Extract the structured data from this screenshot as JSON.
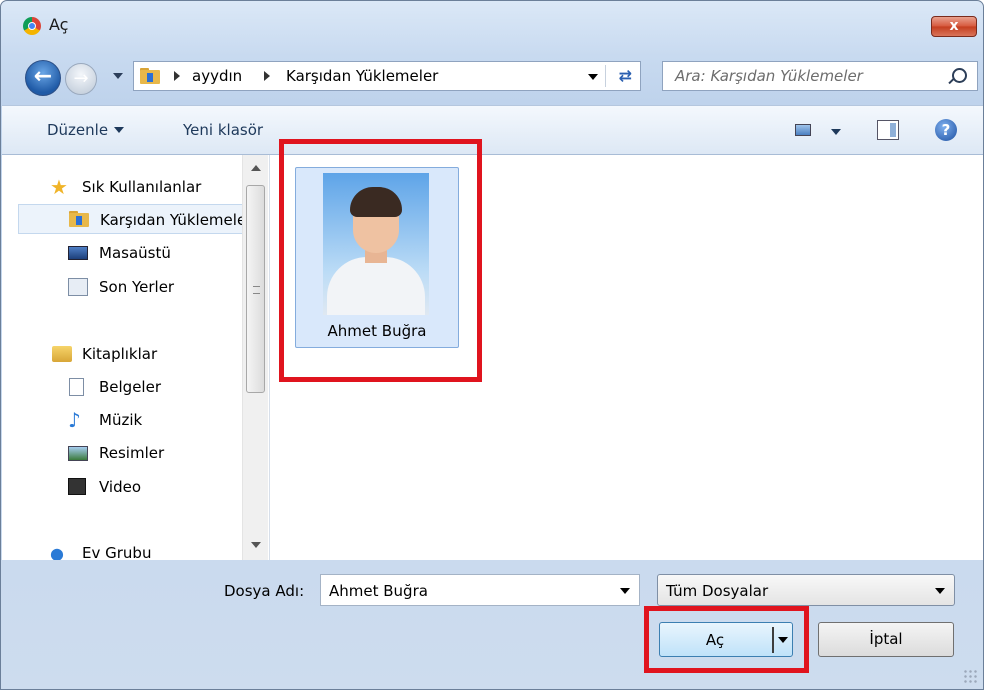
{
  "window": {
    "title": "Aç",
    "close_label": "x"
  },
  "address": {
    "crumbs": [
      "ayydın",
      "Karşıdan Yüklemeler"
    ],
    "search_placeholder": "Ara: Karşıdan Yüklemeler"
  },
  "toolbar": {
    "organize": "Düzenle",
    "new_folder": "Yeni klasör",
    "help": "?"
  },
  "nav": {
    "favorites": "Sık Kullanılanlar",
    "downloads": "Karşıdan Yüklemeler",
    "desktop": "Masaüstü",
    "recent": "Son Yerler",
    "libraries": "Kitaplıklar",
    "documents": "Belgeler",
    "music": "Müzik",
    "pictures": "Resimler",
    "video": "Video",
    "homegroup": "Ev Grubu"
  },
  "files": [
    {
      "name": "Ahmet Buğra"
    }
  ],
  "bottom": {
    "filename_label": "Dosya Adı:",
    "filename_value": "Ahmet Buğra",
    "filetype_value": "Tüm Dosyalar",
    "open_label": "Aç",
    "cancel_label": "İptal"
  },
  "colors": {
    "highlight": "#e0141e",
    "selection": "#d9e8fb"
  }
}
